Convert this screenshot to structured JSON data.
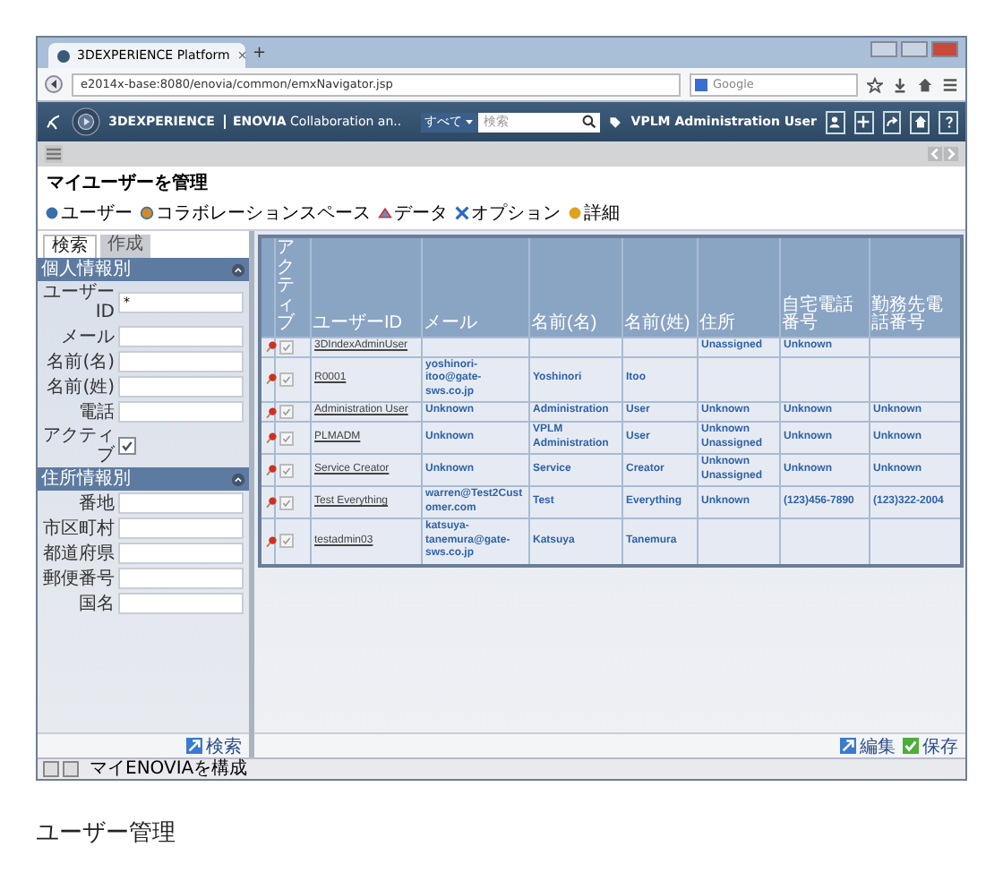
{
  "window": {
    "tab_title": "3DEXPERIENCE Platform",
    "tab_close": "×",
    "new_tab": "+"
  },
  "address_bar": {
    "url": "e2014x-base:8080/enovia/common/emxNavigator.jsp",
    "search_placeholder": "Google"
  },
  "app_header": {
    "brand": "3DEXPERIENCE",
    "app": "**ENOVIA** Collaboration an..",
    "search_scope": "すべて",
    "search_placeholder": "検索",
    "user": "VPLM Administration User"
  },
  "page_title": "マイユーザーを管理",
  "toolbar": [
    {
      "label": "ユーザー"
    },
    {
      "label": "コラボレーションスペース"
    },
    {
      "label": "データ"
    },
    {
      "label": "オプション"
    },
    {
      "label": "詳細"
    }
  ],
  "search_panel": {
    "tabs": [
      {
        "label": "検索",
        "selected": true
      },
      {
        "label": "作成",
        "selected": false
      }
    ],
    "sections": [
      {
        "title": "個人情報別",
        "fields": [
          {
            "kind": "text",
            "label": "ユーザーID",
            "value": "*"
          },
          {
            "kind": "text",
            "label": "メール"
          },
          {
            "kind": "text",
            "label": "名前(名)"
          },
          {
            "kind": "text",
            "label": "名前(姓)"
          },
          {
            "kind": "text",
            "label": "電話"
          },
          {
            "kind": "checkbox",
            "label": "アクティブ",
            "checked": true
          }
        ]
      },
      {
        "title": "住所情報別",
        "fields": [
          {
            "kind": "text",
            "label": "番地"
          },
          {
            "kind": "text",
            "label": "市区町村"
          },
          {
            "kind": "text",
            "label": "都道府県"
          },
          {
            "kind": "text",
            "label": "郵便番号"
          },
          {
            "kind": "text",
            "label": "国名"
          }
        ]
      }
    ],
    "search_button": "検索"
  },
  "table": {
    "active_column": "アクティブ",
    "columns": [
      "ユーザーID",
      "メール",
      "名前(名)",
      "名前(姓)",
      "住所",
      "自宅電話番号",
      "勤務先電話番号"
    ],
    "rows": [
      {
        "active": true,
        "cells": [
          "3DIndexAdminUser",
          null,
          null,
          null,
          "Unassigned",
          "Unknown",
          null
        ]
      },
      {
        "active": true,
        "cells": [
          "R0001",
          "yoshinori-itoo@gate-sws.co.jp",
          "Yoshinori",
          "Itoo",
          null,
          null,
          null
        ]
      },
      {
        "active": true,
        "cells": [
          "Administration User",
          "Unknown",
          "Administration",
          "User",
          "Unknown",
          "Unknown",
          "Unknown"
        ]
      },
      {
        "active": true,
        "cells": [
          "PLMADM",
          "Unknown",
          "VPLM Administration",
          "User",
          "Unknown Unassigned",
          "Unknown",
          "Unknown"
        ]
      },
      {
        "active": true,
        "cells": [
          "Service Creator",
          "Unknown",
          "Service",
          "Creator",
          "Unknown Unassigned",
          "Unknown",
          "Unknown"
        ]
      },
      {
        "active": true,
        "cells": [
          "Test Everything",
          "warren@Test2Customer.com",
          "Test",
          "Everything",
          "Unknown",
          "(123)456-7890",
          "(123)322-2004"
        ]
      },
      {
        "active": true,
        "cells": [
          "testadmin03",
          "katsuya-tanemura@gate-sws.co.jp",
          "Katsuya",
          "Tanemura",
          null,
          null,
          null
        ]
      }
    ]
  },
  "footer_buttons": [
    {
      "label": "編集"
    },
    {
      "label": "保存"
    }
  ],
  "status_bar": "マイENOVIAを構成",
  "caption": "ユーザー管理"
}
